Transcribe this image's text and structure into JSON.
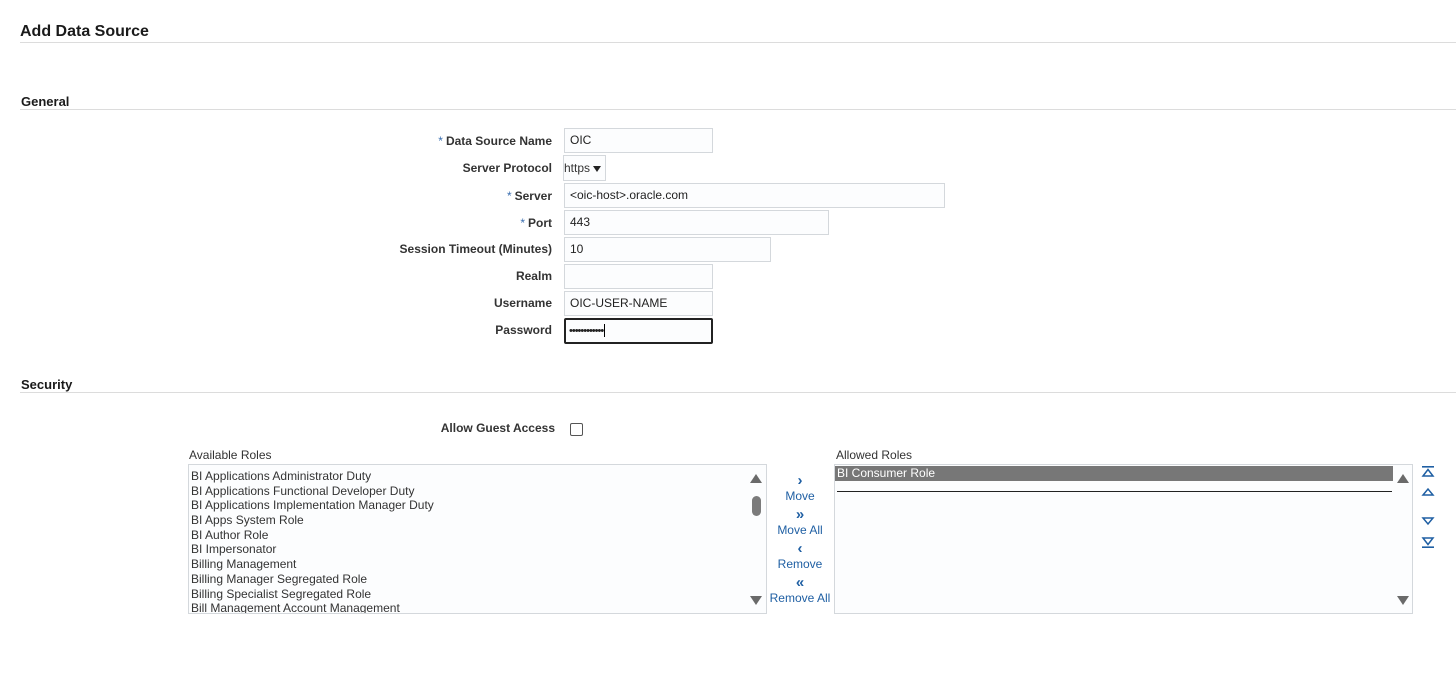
{
  "page": {
    "title": "Add Data Source"
  },
  "general": {
    "title": "General",
    "fields": {
      "data_source_name": {
        "label": "Data Source Name",
        "required": true,
        "value": "OIC"
      },
      "server_protocol": {
        "label": "Server Protocol",
        "value": "https"
      },
      "server": {
        "label": "Server",
        "required": true,
        "value": "<oic-host>.oracle.com"
      },
      "port": {
        "label": "Port",
        "required": true,
        "value": "443"
      },
      "session_timeout": {
        "label": "Session Timeout (Minutes)",
        "value": "10"
      },
      "realm": {
        "label": "Realm",
        "value": ""
      },
      "username": {
        "label": "Username",
        "value": "OIC-USER-NAME"
      },
      "password": {
        "label": "Password",
        "masked_value": "••••••••••••"
      }
    },
    "required_marker": "*"
  },
  "security": {
    "title": "Security",
    "allow_guest_access": {
      "label": "Allow Guest Access",
      "checked": false
    },
    "available_roles": {
      "caption": "Available Roles",
      "items": [
        "BI Applications Administrator Duty",
        "BI Applications Functional Developer Duty",
        "BI Applications Implementation Manager Duty",
        "BI Apps System Role",
        "BI Author Role",
        "BI Impersonator",
        "Billing Management",
        "Billing Manager Segregated Role",
        "Billing Specialist Segregated Role",
        "Bill Management Account Management"
      ]
    },
    "shuttle": {
      "move": "Move",
      "move_all": "Move All",
      "remove": "Remove",
      "remove_all": "Remove All"
    },
    "allowed_roles": {
      "caption": "Allowed Roles",
      "items": [
        "BI Consumer Role"
      ],
      "selected_index": 0
    }
  },
  "colors": {
    "accent": "#1f5fa3",
    "selected_row_bg": "#777777",
    "field_border": "#d4d8dc"
  },
  "icons": {
    "move": "chevron-right-icon",
    "move_all": "double-chevron-right-icon",
    "remove": "chevron-left-icon",
    "remove_all": "double-chevron-left-icon",
    "reorder": [
      "move-to-top-icon",
      "move-up-icon",
      "move-down-icon",
      "move-to-bottom-icon"
    ]
  }
}
